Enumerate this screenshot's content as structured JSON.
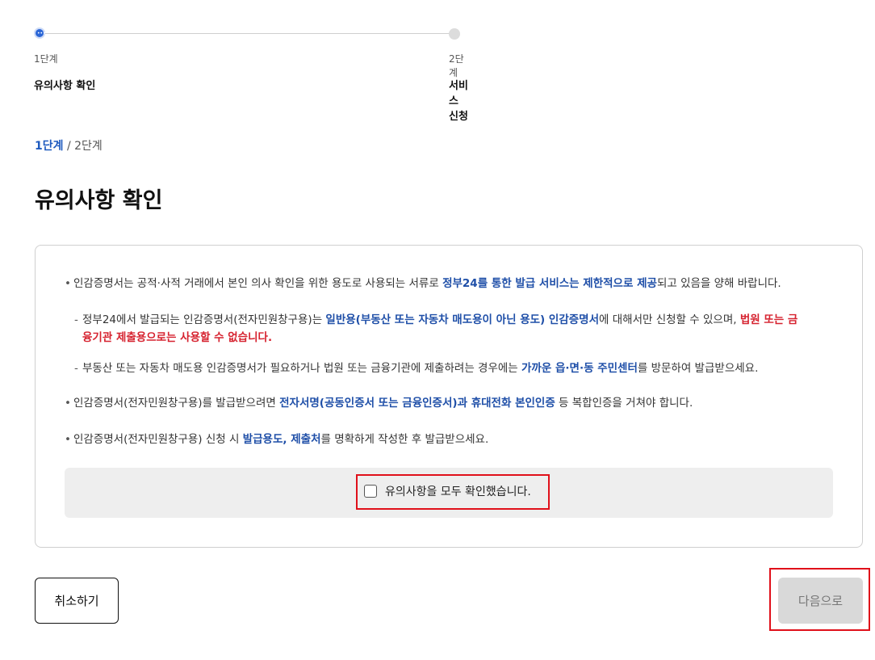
{
  "stepper": {
    "steps": [
      {
        "number": "1단계",
        "title": "유의사항 확인",
        "state": "active"
      },
      {
        "number": "2단계",
        "title": "서비스 신청",
        "state": "inactive"
      }
    ],
    "active_icon": "ellipsis-dots"
  },
  "breadcrumb": {
    "current": "1단계",
    "separator": "/",
    "next": "2단계"
  },
  "page_title": "유의사항 확인",
  "notices": {
    "n1": {
      "a": "인감증명서는 공적·사적 거래에서 본인 의사 확인을 위한 용도로 사용되는 서류로 ",
      "b": "정부24를 통한 발급 서비스는 제한적으로 제공",
      "c": "되고 있음을 양해 바랍니다."
    },
    "n1_sub1": {
      "a": "정부24에서 발급되는 인감증명서(전자민원창구용)는 ",
      "b": "일반용(부동산 또는 자동차 매도용이 아닌 용도) 인감증명서",
      "c": "에 대해서만 신청할 수 있으며, ",
      "d1": "법원 또는 금",
      "d2": "융기관 제출용으로는 사용할 수 없습니다."
    },
    "n1_sub2": {
      "a": "부동산 또는 자동차 매도용 인감증명서가 필요하거나 법원 또는 금융기관에 제출하려는 경우에는 ",
      "b": "가까운 읍·면·동 주민센터",
      "c": "를 방문하여 발급받으세요."
    },
    "n2": {
      "a": "인감증명서(전자민원창구용)를 발급받으려면 ",
      "b": "전자서명(공동인증서 또는 금융인증서)과 휴대전화 본인인증",
      "c": " 등 복합인증을 거쳐야 합니다."
    },
    "n3": {
      "a": "인감증명서(전자민원창구용) 신청 시 ",
      "b": "발급용도, 제출처",
      "c": "를 명확하게 작성한 후 발급받으세요."
    }
  },
  "confirm": {
    "label": "유의사항을 모두 확인했습니다.",
    "checked": false
  },
  "buttons": {
    "cancel": "취소하기",
    "next": "다음으로",
    "next_enabled": false
  },
  "colors": {
    "accent": "#1f5bbf",
    "highlight_blue": "#1f4fa8",
    "warning_red": "#d6222f",
    "annotation_red": "#e0101a"
  }
}
